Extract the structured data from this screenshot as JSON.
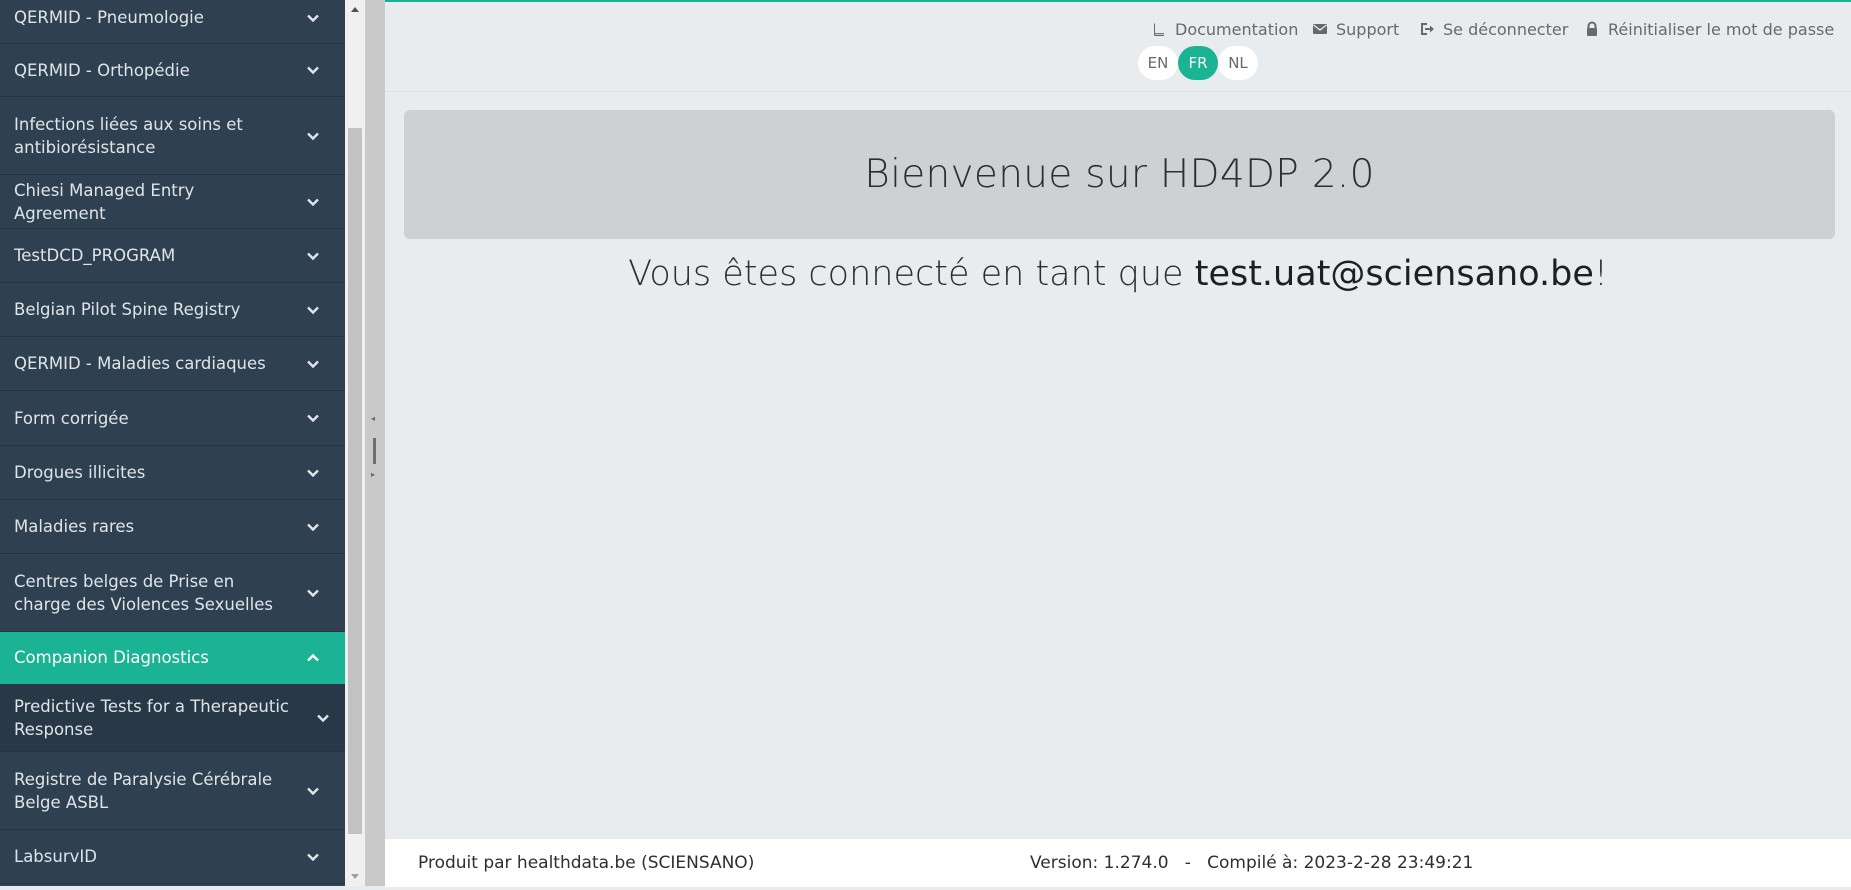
{
  "sidebar": {
    "items": [
      {
        "label": "QERMID - Pneumologie",
        "state": "collapsed"
      },
      {
        "label": "QERMID - Orthopédie",
        "state": "collapsed"
      },
      {
        "label": "Infections liées aux soins et antibiorésistance",
        "state": "collapsed"
      },
      {
        "label": "Chiesi Managed Entry Agreement",
        "state": "collapsed"
      },
      {
        "label": "TestDCD_PROGRAM",
        "state": "collapsed"
      },
      {
        "label": "Belgian Pilot Spine Registry",
        "state": "collapsed"
      },
      {
        "label": "QERMID - Maladies cardiaques",
        "state": "collapsed"
      },
      {
        "label": "Form corrigée",
        "state": "collapsed"
      },
      {
        "label": "Drogues illicites",
        "state": "collapsed"
      },
      {
        "label": "Maladies rares",
        "state": "collapsed"
      },
      {
        "label": "Centres belges de Prise en charge des Violences Sexuelles",
        "state": "collapsed"
      },
      {
        "label": "Companion Diagnostics",
        "state": "expanded"
      },
      {
        "label": "Predictive Tests for a Therapeutic Response",
        "state": "collapsed"
      },
      {
        "label": "Registre de Paralysie Cérébrale Belge ASBL",
        "state": "collapsed"
      },
      {
        "label": "LabsurvID",
        "state": "collapsed"
      }
    ]
  },
  "header": {
    "links": {
      "documentation": "Documentation",
      "support": "Support",
      "logout": "Se déconnecter",
      "reset_password": "Réinitialiser le mot de passe"
    },
    "languages": [
      "EN",
      "FR",
      "NL"
    ],
    "selected_language": "FR"
  },
  "main": {
    "welcome_title": "Bienvenue sur HD4DP 2.0",
    "connected_prefix": "Vous êtes connecté en tant que ",
    "connected_user": "test.uat@sciensano.be",
    "connected_suffix": "!"
  },
  "footer": {
    "producer": "Produit par healthdata.be (SCIENSANO)",
    "version_label": "Version:",
    "version": "1.274.0",
    "separator": "-",
    "compiled_label": "Compilé à:",
    "compiled_at": "2023-2-28 23:49:21"
  },
  "colors": {
    "sidebar_bg": "#2f4050",
    "accent": "#1ab394",
    "sub_item_bg": "#293846",
    "main_bg": "#e9ecef",
    "welcome_bg": "#cdd1d4"
  },
  "icons": {
    "documentation": "book-icon",
    "support": "envelope-icon",
    "logout": "sign-out-icon",
    "reset_password": "lock-icon",
    "nav_collapsed": "chevron-down-icon",
    "nav_expanded": "chevron-up-icon"
  }
}
